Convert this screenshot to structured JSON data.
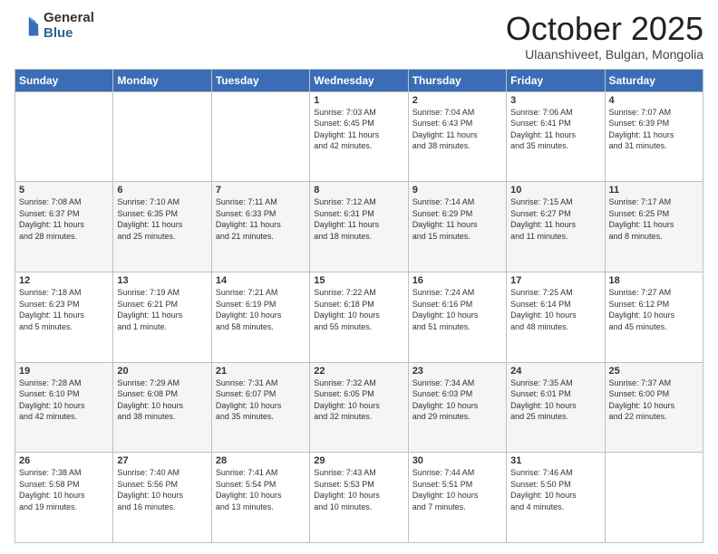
{
  "logo": {
    "general": "General",
    "blue": "Blue"
  },
  "header": {
    "month": "October 2025",
    "location": "Ulaanshiveet, Bulgan, Mongolia"
  },
  "weekdays": [
    "Sunday",
    "Monday",
    "Tuesday",
    "Wednesday",
    "Thursday",
    "Friday",
    "Saturday"
  ],
  "weeks": [
    [
      {
        "day": "",
        "info": ""
      },
      {
        "day": "",
        "info": ""
      },
      {
        "day": "",
        "info": ""
      },
      {
        "day": "1",
        "info": "Sunrise: 7:03 AM\nSunset: 6:45 PM\nDaylight: 11 hours\nand 42 minutes."
      },
      {
        "day": "2",
        "info": "Sunrise: 7:04 AM\nSunset: 6:43 PM\nDaylight: 11 hours\nand 38 minutes."
      },
      {
        "day": "3",
        "info": "Sunrise: 7:06 AM\nSunset: 6:41 PM\nDaylight: 11 hours\nand 35 minutes."
      },
      {
        "day": "4",
        "info": "Sunrise: 7:07 AM\nSunset: 6:39 PM\nDaylight: 11 hours\nand 31 minutes."
      }
    ],
    [
      {
        "day": "5",
        "info": "Sunrise: 7:08 AM\nSunset: 6:37 PM\nDaylight: 11 hours\nand 28 minutes."
      },
      {
        "day": "6",
        "info": "Sunrise: 7:10 AM\nSunset: 6:35 PM\nDaylight: 11 hours\nand 25 minutes."
      },
      {
        "day": "7",
        "info": "Sunrise: 7:11 AM\nSunset: 6:33 PM\nDaylight: 11 hours\nand 21 minutes."
      },
      {
        "day": "8",
        "info": "Sunrise: 7:12 AM\nSunset: 6:31 PM\nDaylight: 11 hours\nand 18 minutes."
      },
      {
        "day": "9",
        "info": "Sunrise: 7:14 AM\nSunset: 6:29 PM\nDaylight: 11 hours\nand 15 minutes."
      },
      {
        "day": "10",
        "info": "Sunrise: 7:15 AM\nSunset: 6:27 PM\nDaylight: 11 hours\nand 11 minutes."
      },
      {
        "day": "11",
        "info": "Sunrise: 7:17 AM\nSunset: 6:25 PM\nDaylight: 11 hours\nand 8 minutes."
      }
    ],
    [
      {
        "day": "12",
        "info": "Sunrise: 7:18 AM\nSunset: 6:23 PM\nDaylight: 11 hours\nand 5 minutes."
      },
      {
        "day": "13",
        "info": "Sunrise: 7:19 AM\nSunset: 6:21 PM\nDaylight: 11 hours\nand 1 minute."
      },
      {
        "day": "14",
        "info": "Sunrise: 7:21 AM\nSunset: 6:19 PM\nDaylight: 10 hours\nand 58 minutes."
      },
      {
        "day": "15",
        "info": "Sunrise: 7:22 AM\nSunset: 6:18 PM\nDaylight: 10 hours\nand 55 minutes."
      },
      {
        "day": "16",
        "info": "Sunrise: 7:24 AM\nSunset: 6:16 PM\nDaylight: 10 hours\nand 51 minutes."
      },
      {
        "day": "17",
        "info": "Sunrise: 7:25 AM\nSunset: 6:14 PM\nDaylight: 10 hours\nand 48 minutes."
      },
      {
        "day": "18",
        "info": "Sunrise: 7:27 AM\nSunset: 6:12 PM\nDaylight: 10 hours\nand 45 minutes."
      }
    ],
    [
      {
        "day": "19",
        "info": "Sunrise: 7:28 AM\nSunset: 6:10 PM\nDaylight: 10 hours\nand 42 minutes."
      },
      {
        "day": "20",
        "info": "Sunrise: 7:29 AM\nSunset: 6:08 PM\nDaylight: 10 hours\nand 38 minutes."
      },
      {
        "day": "21",
        "info": "Sunrise: 7:31 AM\nSunset: 6:07 PM\nDaylight: 10 hours\nand 35 minutes."
      },
      {
        "day": "22",
        "info": "Sunrise: 7:32 AM\nSunset: 6:05 PM\nDaylight: 10 hours\nand 32 minutes."
      },
      {
        "day": "23",
        "info": "Sunrise: 7:34 AM\nSunset: 6:03 PM\nDaylight: 10 hours\nand 29 minutes."
      },
      {
        "day": "24",
        "info": "Sunrise: 7:35 AM\nSunset: 6:01 PM\nDaylight: 10 hours\nand 25 minutes."
      },
      {
        "day": "25",
        "info": "Sunrise: 7:37 AM\nSunset: 6:00 PM\nDaylight: 10 hours\nand 22 minutes."
      }
    ],
    [
      {
        "day": "26",
        "info": "Sunrise: 7:38 AM\nSunset: 5:58 PM\nDaylight: 10 hours\nand 19 minutes."
      },
      {
        "day": "27",
        "info": "Sunrise: 7:40 AM\nSunset: 5:56 PM\nDaylight: 10 hours\nand 16 minutes."
      },
      {
        "day": "28",
        "info": "Sunrise: 7:41 AM\nSunset: 5:54 PM\nDaylight: 10 hours\nand 13 minutes."
      },
      {
        "day": "29",
        "info": "Sunrise: 7:43 AM\nSunset: 5:53 PM\nDaylight: 10 hours\nand 10 minutes."
      },
      {
        "day": "30",
        "info": "Sunrise: 7:44 AM\nSunset: 5:51 PM\nDaylight: 10 hours\nand 7 minutes."
      },
      {
        "day": "31",
        "info": "Sunrise: 7:46 AM\nSunset: 5:50 PM\nDaylight: 10 hours\nand 4 minutes."
      },
      {
        "day": "",
        "info": ""
      }
    ]
  ]
}
